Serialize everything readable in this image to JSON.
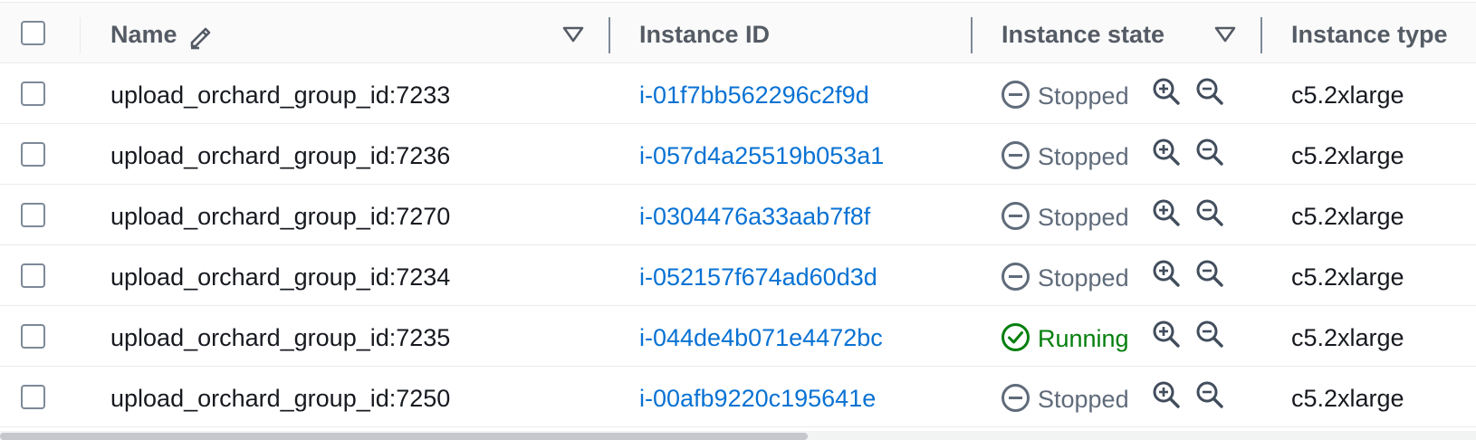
{
  "columns": {
    "name": "Name",
    "instance_id": "Instance ID",
    "instance_state": "Instance state",
    "instance_type": "Instance type"
  },
  "icons": {
    "edit": "pencil-icon",
    "sort": "caret-down-icon",
    "stopped": "stopped-icon",
    "running": "check-circle-icon",
    "zoom_in": "zoom-in-icon",
    "zoom_out": "zoom-out-icon"
  },
  "colors": {
    "link": "#0972d3",
    "stopped": "#5f6b7a",
    "running": "#037f0c"
  },
  "rows": [
    {
      "name": "upload_orchard_group_id:7233",
      "instance_id": "i-01f7bb562296c2f9d",
      "state": "Stopped",
      "type": "c5.2xlarge"
    },
    {
      "name": "upload_orchard_group_id:7236",
      "instance_id": "i-057d4a25519b053a1",
      "state": "Stopped",
      "type": "c5.2xlarge"
    },
    {
      "name": "upload_orchard_group_id:7270",
      "instance_id": "i-0304476a33aab7f8f",
      "state": "Stopped",
      "type": "c5.2xlarge"
    },
    {
      "name": "upload_orchard_group_id:7234",
      "instance_id": "i-052157f674ad60d3d",
      "state": "Stopped",
      "type": "c5.2xlarge"
    },
    {
      "name": "upload_orchard_group_id:7235",
      "instance_id": "i-044de4b071e4472bc",
      "state": "Running",
      "type": "c5.2xlarge"
    },
    {
      "name": "upload_orchard_group_id:7250",
      "instance_id": "i-00afb9220c195641e",
      "state": "Stopped",
      "type": "c5.2xlarge"
    }
  ]
}
